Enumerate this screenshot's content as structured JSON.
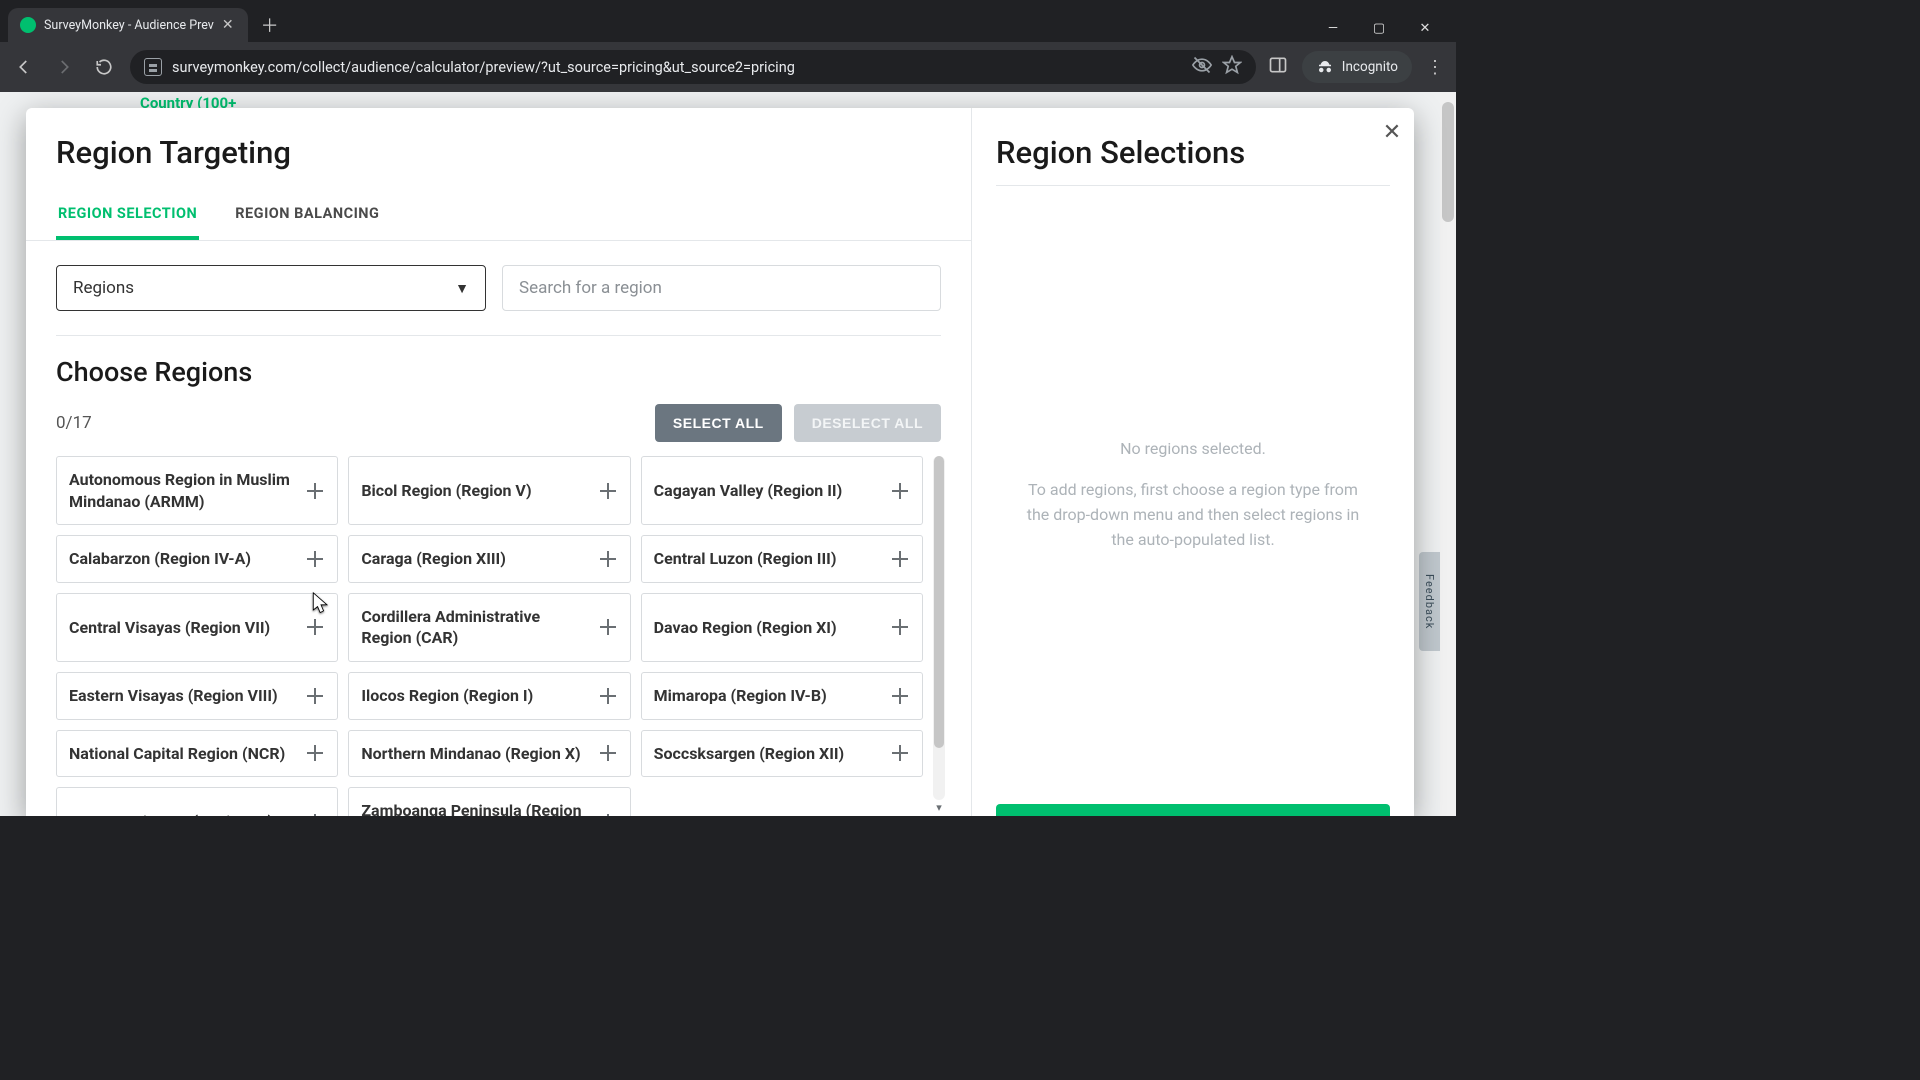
{
  "browser": {
    "tab_title": "SurveyMonkey - Audience Prev",
    "url": "surveymonkey.com/collect/audience/calculator/preview/?ut_source=pricing&ut_source2=pricing",
    "incognito_label": "Incognito"
  },
  "background": {
    "country_hint": "Country (100+",
    "feedback_label": "Feedback"
  },
  "modal": {
    "title": "Region Targeting",
    "tabs": {
      "selection": "REGION SELECTION",
      "balancing": "REGION BALANCING"
    },
    "select": {
      "label": "Regions"
    },
    "search": {
      "placeholder": "Search for a region"
    },
    "choose_heading": "Choose Regions",
    "count_text": "0/17",
    "buttons": {
      "select_all": "SELECT ALL",
      "deselect_all": "DESELECT ALL"
    },
    "regions_col1": [
      "Autonomous Region in Muslim Mindanao (ARMM)",
      "Calabarzon (Region IV-A)",
      "Central Visayas (Region VII)",
      "Eastern Visayas (Region VIII)",
      "National Capital Region (NCR)",
      "Western Visayas (Region VI)"
    ],
    "regions_col2": [
      "Bicol Region (Region V)",
      "Caraga (Region XIII)",
      "Cordillera Administrative Region (CAR)",
      "Ilocos Region (Region I)",
      "Northern Mindanao (Region X)",
      "Zamboanga Peninsula (Region IX)"
    ],
    "regions_col3": [
      "Cagayan Valley (Region II)",
      "Central Luzon (Region III)",
      "Davao Region (Region XI)",
      "Mimaropa (Region IV-B)",
      "Soccsksargen (Region XII)"
    ]
  },
  "right": {
    "title": "Region Selections",
    "empty_title": "No regions selected.",
    "empty_body": "To add regions, first choose a region type from the drop-down menu and then select regions in the auto-populated list."
  }
}
